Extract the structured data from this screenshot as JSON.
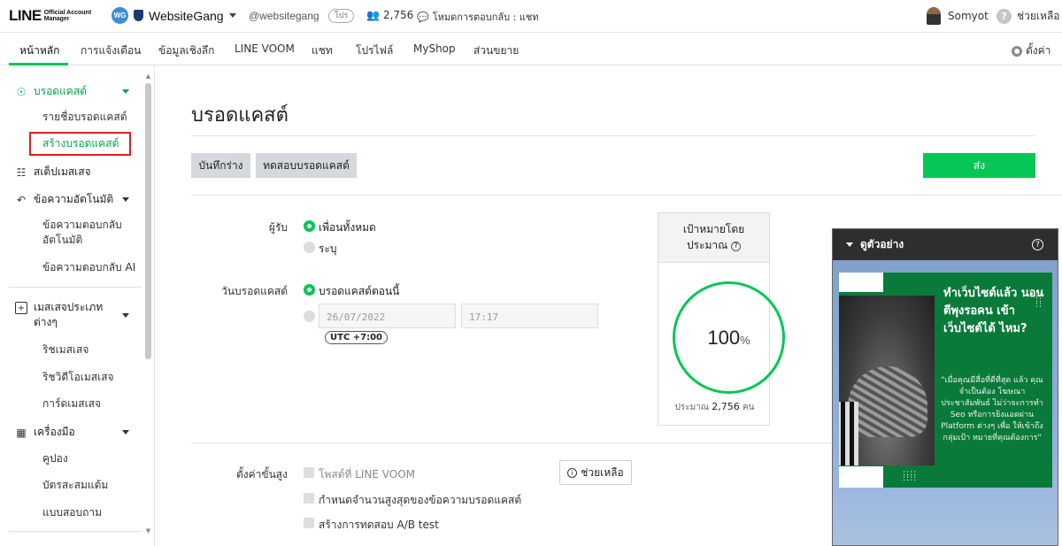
{
  "header": {
    "logo_main": "LINE",
    "logo_sub_1": "Official Account",
    "logo_sub_2": "Manager",
    "account_initials": "WG",
    "account_name": "WebsiteGang",
    "account_id": "@websitegang",
    "plan_badge": "โปร",
    "friend_count": "2,756",
    "chat_mode": "โหมดการตอบกลับ : แชท",
    "user_name": "Somyot",
    "help_label": "ช่วยเหลือ"
  },
  "nav": {
    "tabs": [
      "หน้าหลัก",
      "การแจ้งเตือน",
      "ข้อมูลเชิงลึก",
      "LINE VOOM",
      "แชท",
      "โปรไฟล์",
      "MyShop",
      "ส่วนขยาย"
    ],
    "active_tab": "หน้าหลัก",
    "settings_label": "ตั้งค่า"
  },
  "sidebar": {
    "broadcast": "บรอดแคสต์",
    "broadcast_list": "รายชื่อบรอดแคสต์",
    "create_broadcast": "สร้างบรอดแคสต์",
    "step_message": "สเต็ปเมสเสจ",
    "auto_reply": "ข้อความอัตโนมัติ",
    "auto_reply_msg_1": "ข้อความตอบกลับ",
    "auto_reply_msg_2": "อัตโนมัติ",
    "ai_reply": "ข้อความตอบกลับ AI",
    "message_types_1": "เมสเสจประเภท",
    "message_types_2": "ต่างๆ",
    "rich_message": "ริชเมสเสจ",
    "rich_video": "ริชวิดีโอเมสเสจ",
    "card_message": "การ์ดเมสเสจ",
    "tools": "เครื่องมือ",
    "coupon": "คูปอง",
    "reward_card": "บัตรสะสมแต้ม",
    "survey": "แบบสอบถาม"
  },
  "main": {
    "title": "บรอดแคสต์",
    "save_draft": "บันทึกร่าง",
    "test_broadcast": "ทดสอบบรอดแคสต์",
    "send": "ส่ง",
    "recipients_label": "ผู้รับ",
    "all_friends": "เพื่อนทั้งหมด",
    "specify": "ระบุ",
    "recipients_selected": "เพื่อนทั้งหมด",
    "date_label": "วันบรอดแคสต์",
    "broadcast_now": "บรอดแคสต์ตอนนี้",
    "date_selected": "บรอดแคสต์ตอนนี้",
    "date_value": "26/07/2022",
    "time_value": "17:17",
    "timezone": "UTC +7:00",
    "target_title_1": "เป้าหมายโดย",
    "target_title_2": "ประมาณ",
    "target_percent": "100",
    "target_percent_unit": "%",
    "target_estimate_prefix": "ประมาณ",
    "target_estimate_value": "2,756",
    "target_estimate_unit": "คน",
    "advanced_label": "ตั้งค่าขั้นสูง",
    "opt_voom": "โพสต์ที่ LINE VOOM",
    "opt_limit": "กำหนดจำนวนสูงสุดของข้อความบรอดแคสต์",
    "opt_ab": "สร้างการทดสอบ A/B test",
    "help_button": "ช่วยเหลือ"
  },
  "preview": {
    "title": "ดูตัวอย่าง",
    "card_title": "ทำเว็บไซต์แล้ว นอนตีพุงรอคน เข้าเว็บไซต์ได้ ไหม?",
    "card_body": "\"เมื่อคุณมีสื่อที่ดีที่สุด แล้ว คุณจำเป็นต้อง โฆษณาประชาสัมพันธ์ ไม่ว่าจะการทำ Seo หรือการยิงแอดผ่าน Platform ต่างๆ เพื่อ ให้เข้าถึงกลุ่มเป้า หมายที่คุณต้องการ\""
  },
  "colors": {
    "brand_green": "#06c755",
    "highlight_red": "#e01e1e",
    "card_green": "#0a7a3a"
  },
  "icons": {
    "broadcast": "broadcast-icon",
    "step": "step-message-icon",
    "auto_reply": "reply-icon",
    "message_types": "message-plus-icon",
    "tools": "tools-icon"
  }
}
